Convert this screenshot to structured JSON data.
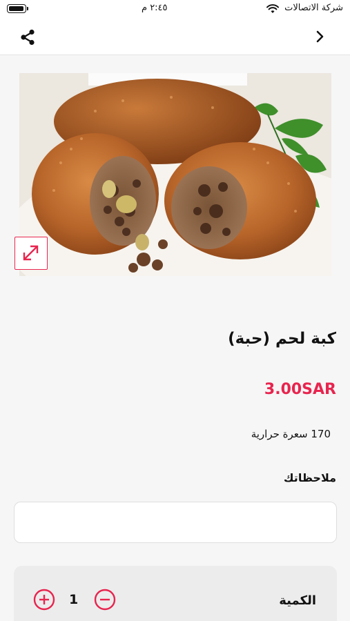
{
  "status_bar": {
    "carrier": "شركة الاتصالات",
    "time": "٢:٤٥ م"
  },
  "product": {
    "title": "كبة لحم (حبة)",
    "price": "3.00SAR",
    "calories": "170 سعرة حرارية"
  },
  "notes": {
    "label": "ملاحظاتك",
    "value": "",
    "placeholder": ""
  },
  "quantity": {
    "label": "الكمية",
    "value": "1"
  },
  "colors": {
    "accent": "#e8244e"
  },
  "icons": {
    "share": "share-icon",
    "back": "chevron-right-icon",
    "expand": "expand-icon",
    "plus": "plus-circle-icon",
    "minus": "minus-circle-icon"
  }
}
